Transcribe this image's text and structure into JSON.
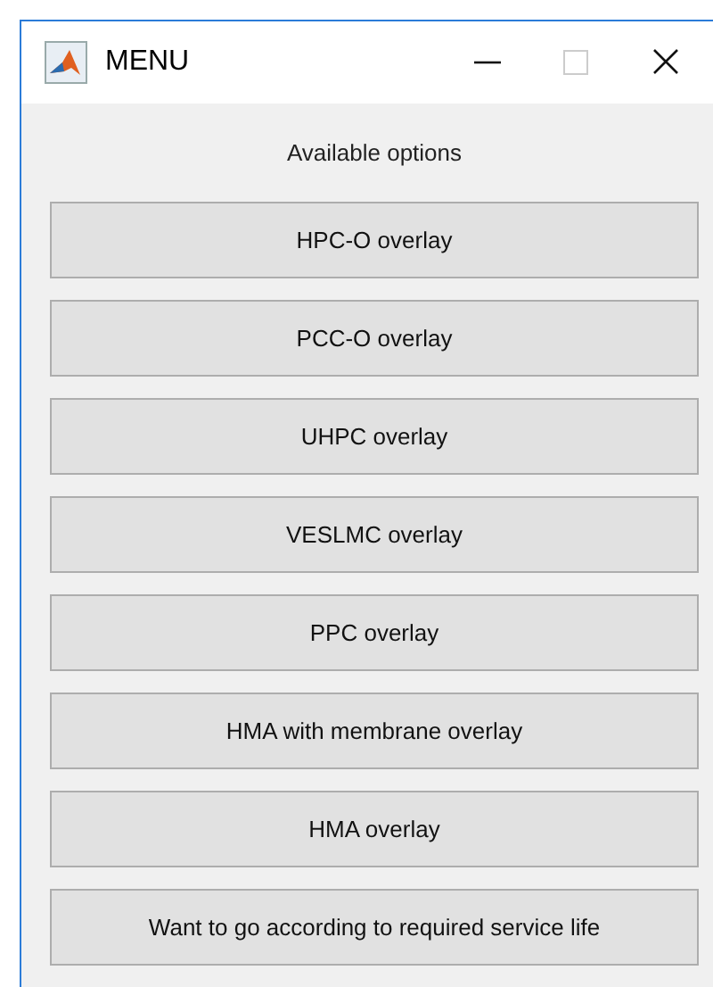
{
  "window": {
    "title": "MENU"
  },
  "heading": "Available options",
  "buttons": [
    "HPC-O overlay",
    "PCC-O overlay",
    "UHPC overlay",
    "VESLMC overlay",
    "PPC overlay",
    "HMA with membrane overlay",
    "HMA overlay",
    "Want to go according to required service life"
  ]
}
